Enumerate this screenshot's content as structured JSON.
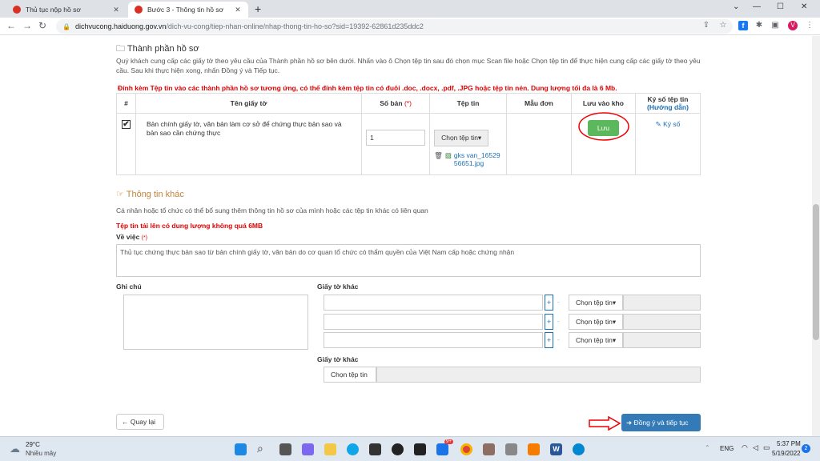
{
  "browser": {
    "tabs": [
      {
        "title": "Thủ tục nộp hồ sơ"
      },
      {
        "title": "Bước 3 - Thông tin hồ sơ"
      }
    ],
    "new_tab_glyph": "+",
    "address": {
      "host": "dichvucong.haiduong.gov.vn",
      "path": "/dich-vu-cong/tiep-nhan-online/nhap-thong-tin-ho-so?sid=19392-62861d235ddc2"
    },
    "profile_initial": "V",
    "extension_fb": "f"
  },
  "docs_section": {
    "title": "Thành phần hồ sơ",
    "intro": "Quý khách cung cấp các giấy tờ theo yêu cầu của Thành phần hồ sơ bên dưới. Nhấn vào ô Chọn tệp tin sau đó chọn mục Scan file hoặc Chọn tệp tin để thực hiện cung cấp các giấy tờ theo yêu cầu. Sau khi thực hiện xong, nhấn Đồng ý và Tiếp tục.",
    "warning": "Đính kèm Tệp tin vào các thành phần hồ sơ tương ứng, có thể đính kèm tệp tin có đuôi .doc, .docx, .pdf, .JPG hoặc tệp tin nén. Dung lượng tối đa là 6 Mb.",
    "headers": {
      "num": "#",
      "name": "Tên giấy tờ",
      "count": "Số bản",
      "count_req": "(*)",
      "file": "Tệp tin",
      "template": "Mẫu đơn",
      "save": "Lưu vào kho",
      "sign": "Ký số tệp tin",
      "sign_help": "(Hướng dẫn)"
    },
    "row": {
      "checked": "✔",
      "name": "Bản chính giấy tờ, văn bản làm cơ sở để chứng thực bản sao và bản sao cần chứng thực",
      "count": "1",
      "choose_file": "Chọn tệp tin",
      "file_name": "gks van_1652956651.jpg",
      "save_button": "Lưu",
      "sign_link": "Ký số"
    }
  },
  "other_section": {
    "title": "Thông tin khác",
    "intro": "Cá nhân hoặc tổ chức có thể bổ sung thêm thông tin hồ sơ của mình hoặc các tệp tin khác có liên quan",
    "warning": "Tệp tin tải lên có dung lượng không quá 6MB",
    "subject_label": "Về việc",
    "subject_req": "(*)",
    "subject_value": "Thủ tục chứng thực bản sao từ bản chính giấy tờ, văn bản do cơ quan tổ chức có thẩm quyền của Việt Nam cấp hoặc chứng nhận",
    "notes_label": "Ghi chú",
    "other_docs_label": "Giấy tờ khác",
    "other_docs_label2": "Giấy tờ khác",
    "choose_file": "Chọn tệp tin",
    "plus": "+",
    "minus": "-"
  },
  "actions": {
    "back": "Quay lại",
    "next": "Đồng ý và tiếp tục"
  },
  "taskbar": {
    "weather_temp": "29°C",
    "weather_desc": "Nhiều mây",
    "lang": "ENG",
    "time": "5:37 PM",
    "date": "5/19/2022",
    "notification_count": "2",
    "badge": "9+"
  }
}
